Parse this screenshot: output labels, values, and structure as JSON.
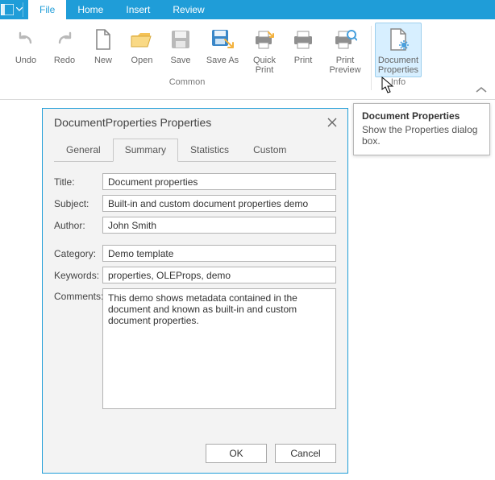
{
  "tabs": {
    "file": "File",
    "home": "Home",
    "insert": "Insert",
    "review": "Review"
  },
  "ribbon": {
    "undo": "Undo",
    "redo": "Redo",
    "new": "New",
    "open": "Open",
    "save": "Save",
    "saveas": "Save As",
    "quickprint": "Quick Print",
    "print": "Print",
    "printpreview": "Print Preview",
    "docprops": "Document Properties",
    "group_common": "Common",
    "group_info": "Info"
  },
  "tooltip": {
    "title": "Document Properties",
    "body": "Show the Properties dialog box."
  },
  "dialog": {
    "title": "DocumentProperties Properties",
    "tabs": {
      "general": "General",
      "summary": "Summary",
      "statistics": "Statistics",
      "custom": "Custom"
    },
    "labels": {
      "title": "Title:",
      "subject": "Subject:",
      "author": "Author:",
      "category": "Category:",
      "keywords": "Keywords:",
      "comments": "Comments:"
    },
    "values": {
      "title": "Document properties",
      "subject": "Built-in and custom document properties demo",
      "author": "John Smith",
      "category": "Demo template",
      "keywords": "properties, OLEProps, demo",
      "comments": "This demo shows metadata contained in the document and known as built-in and custom document properties."
    },
    "buttons": {
      "ok": "OK",
      "cancel": "Cancel"
    }
  }
}
